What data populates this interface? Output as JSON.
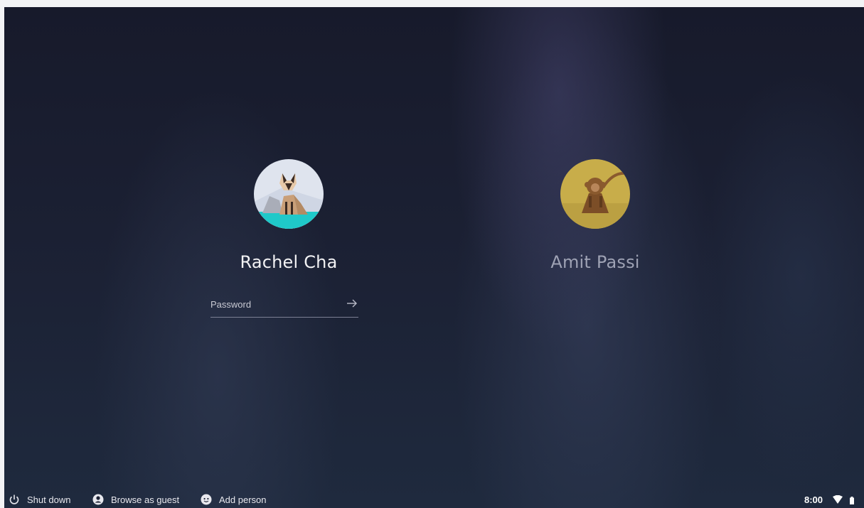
{
  "users": [
    {
      "name": "Rachel Cha",
      "avatar_icon": "cat-avatar-icon",
      "avatar_colors": {
        "sky": "#dfe4ee",
        "ground": "#1fc9c9"
      },
      "password_placeholder": "Password",
      "password_value": ""
    },
    {
      "name": "Amit Passi",
      "avatar_icon": "monkey-avatar-icon",
      "avatar_colors": {
        "bg": "#c8ad4a",
        "figure": "#8a5a2e"
      }
    }
  ],
  "shelf": {
    "shutdown_label": "Shut down",
    "guest_label": "Browse as guest",
    "add_person_label": "Add person"
  },
  "status": {
    "time": "8:00",
    "wifi_icon": "wifi-icon",
    "battery_icon": "battery-icon"
  },
  "colors": {
    "background_dark": "#171a2b",
    "text_primary": "#f2f2f4",
    "text_secondary": "#9ea2b4"
  }
}
